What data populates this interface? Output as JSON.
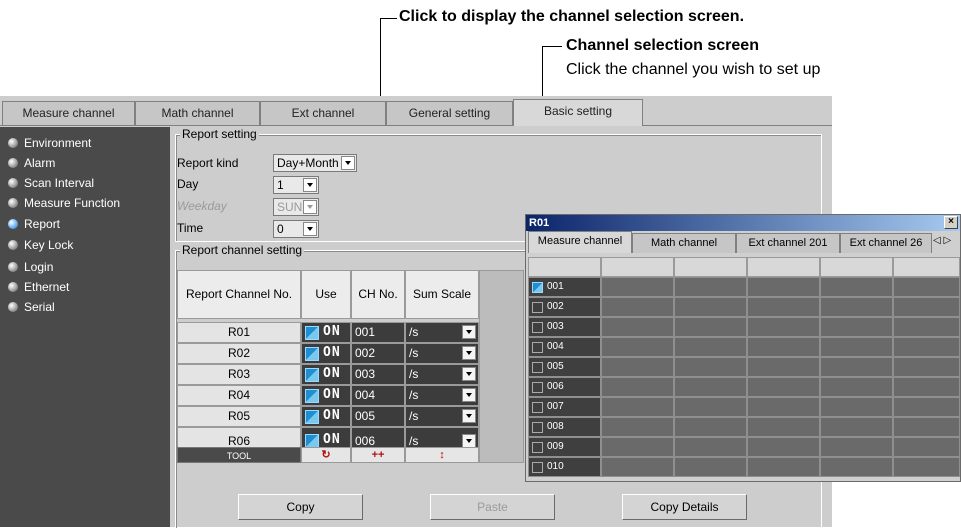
{
  "callouts": {
    "line1": "Click to display the channel selection screen.",
    "line2": "Channel selection screen",
    "line3": "Click the channel you wish to set up"
  },
  "tabs": [
    {
      "label": "Measure channel",
      "active": false
    },
    {
      "label": "Math channel",
      "active": false
    },
    {
      "label": "Ext channel",
      "active": false
    },
    {
      "label": "General setting",
      "active": false
    },
    {
      "label": "Basic setting",
      "active": true
    }
  ],
  "sidebar": {
    "items": [
      {
        "label": "Environment",
        "selected": false
      },
      {
        "label": "Alarm",
        "selected": false
      },
      {
        "label": "Scan Interval",
        "selected": false
      },
      {
        "label": "Measure Function",
        "selected": false
      },
      {
        "label": "Report",
        "selected": true
      },
      {
        "label": "Key Lock",
        "selected": false
      },
      {
        "label": "Login",
        "selected": false
      },
      {
        "label": "Ethernet",
        "selected": false
      },
      {
        "label": "Serial",
        "selected": false
      }
    ]
  },
  "report_setting": {
    "group_title": "Report setting",
    "report_kind_label": "Report kind",
    "report_kind_value": "Day+Month",
    "day_label": "Day",
    "day_value": "1",
    "weekday_label": "Weekday",
    "weekday_value": "SUN",
    "time_label": "Time",
    "time_value": "0"
  },
  "report_channel_setting": {
    "group_title": "Report channel setting",
    "headers": [
      "Report Channel No.",
      "Use",
      "CH No.",
      "Sum Scale"
    ],
    "rows": [
      {
        "no": "R01",
        "use": "ON",
        "ch": "001",
        "scale": "/s"
      },
      {
        "no": "R02",
        "use": "ON",
        "ch": "002",
        "scale": "/s"
      },
      {
        "no": "R03",
        "use": "ON",
        "ch": "003",
        "scale": "/s"
      },
      {
        "no": "R04",
        "use": "ON",
        "ch": "004",
        "scale": "/s"
      },
      {
        "no": "R05",
        "use": "ON",
        "ch": "005",
        "scale": "/s"
      },
      {
        "no": "R06",
        "use": "ON",
        "ch": "006",
        "scale": "/s"
      }
    ],
    "tool_label": "TOOL",
    "tool_buttons": [
      "↻",
      "++",
      "↕"
    ]
  },
  "buttons": {
    "copy": "Copy",
    "paste": "Paste",
    "copy_details": "Copy Details"
  },
  "popup": {
    "title": "R01",
    "close": "×",
    "tabs": [
      "Measure channel",
      "Math channel",
      "Ext channel 201",
      "Ext channel 26"
    ],
    "arrows": "◁ ▷",
    "channels": [
      {
        "label": "001",
        "checked": true
      },
      {
        "label": "002",
        "checked": false
      },
      {
        "label": "003",
        "checked": false
      },
      {
        "label": "004",
        "checked": false
      },
      {
        "label": "005",
        "checked": false
      },
      {
        "label": "006",
        "checked": false
      },
      {
        "label": "007",
        "checked": false
      },
      {
        "label": "008",
        "checked": false
      },
      {
        "label": "009",
        "checked": false
      },
      {
        "label": "010",
        "checked": false
      }
    ]
  },
  "colors": {
    "sidebar_bg": "#4a4a4a",
    "panel_bg": "#cdcdcd",
    "check_blue": "#1e8fd0",
    "title_bar": "#0a246a"
  }
}
